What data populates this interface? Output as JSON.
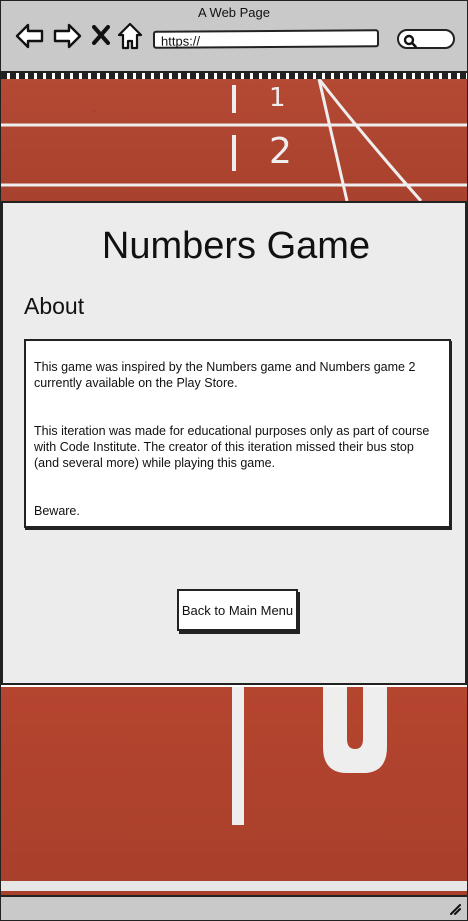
{
  "browser": {
    "title": "A Web Page",
    "url": "https://"
  },
  "page": {
    "title": "Numbers Game",
    "section_heading": "About",
    "paragraphs": [
      "This game was inspired by the Numbers game and Numbers game 2 currently available on the Play Store.",
      "This iteration was made for educational purposes only as part of course with Code Institute. The creator of this iteration missed their bus stop (and several more) while playing this game.",
      "Beware."
    ],
    "back_button_label": "Back to Main Menu"
  },
  "track": {
    "top_lane_numbers": [
      "1",
      "2"
    ]
  },
  "icons": {
    "back": "back-arrow-icon",
    "forward": "forward-arrow-icon",
    "stop": "close-icon",
    "home": "home-icon",
    "search": "search-icon",
    "resize": "resize-handle-icon"
  },
  "colors": {
    "track": "#b0432f",
    "card": "#ececec",
    "chrome": "#c9c9c9"
  }
}
